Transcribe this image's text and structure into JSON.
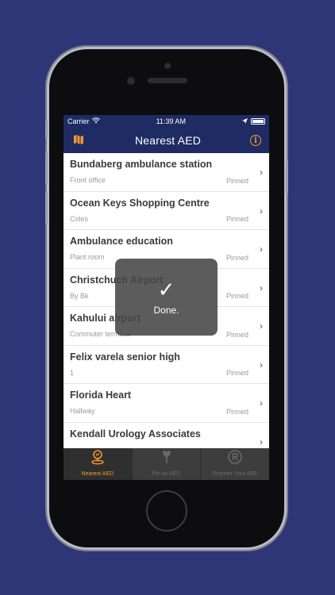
{
  "status": {
    "carrier": "Carrier",
    "time": "11:39 AM"
  },
  "nav": {
    "title": "Nearest AED"
  },
  "rows": [
    {
      "name": "Bundaberg ambulance station",
      "sub": "Front office",
      "pinned": "Pinned"
    },
    {
      "name": "Ocean Keys Shopping Centre",
      "sub": "Coles",
      "pinned": "Pinned"
    },
    {
      "name": "Ambulance education",
      "sub": "Plant room",
      "pinned": "Pinned"
    },
    {
      "name": "Christchuch Airport",
      "sub": "By Bk",
      "pinned": "Pinned"
    },
    {
      "name": "Kahului airport",
      "sub": "Commuter terminal",
      "pinned": "Pinned"
    },
    {
      "name": "Felix varela senior high",
      "sub": "1",
      "pinned": "Pinned"
    },
    {
      "name": "Florida Heart",
      "sub": "Hallway",
      "pinned": "Pinned"
    },
    {
      "name": "Kendall Urology Associates",
      "sub": "",
      "pinned": ""
    }
  ],
  "toast": {
    "check": "✓",
    "text": "Done."
  },
  "tabs": [
    {
      "label": "Nearest AED",
      "icon": "map-pin-icon"
    },
    {
      "label": "Pin an AED",
      "icon": "heart-pin-icon"
    },
    {
      "label": "Register Your AED",
      "icon": "registered-icon"
    }
  ],
  "colors": {
    "nav": "#1f2b63",
    "accent": "#f29a2e",
    "background": "#2e3678"
  }
}
